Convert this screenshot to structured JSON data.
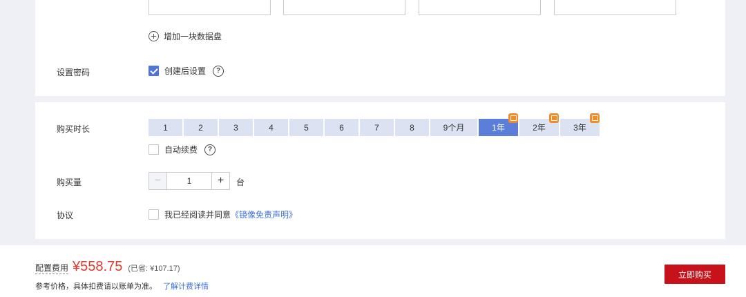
{
  "disk_section": {
    "add_disk_label": "增加一块数据盘"
  },
  "password": {
    "label": "设置密码",
    "option_label": "创建后设置",
    "checked": true
  },
  "duration": {
    "label": "购买时长",
    "options": [
      "1",
      "2",
      "3",
      "4",
      "5",
      "6",
      "7",
      "8",
      "9个月",
      "1年",
      "2年",
      "3年"
    ],
    "selected": "1年",
    "auto_renew_label": "自动续费",
    "auto_renew_checked": false
  },
  "quantity": {
    "label": "购买量",
    "value": "1",
    "minus": "−",
    "plus": "+",
    "unit": "台"
  },
  "agreement": {
    "label": "协议",
    "text": "我已经阅读并同意",
    "link_text": "《镜像免责声明》",
    "checked": false
  },
  "footer": {
    "price_label": "配置费用",
    "price": "¥558.75",
    "saved": "(已省: ¥107.17)",
    "note": "参考价格，具体扣费请以账单为准。",
    "note_link": "了解计费详情",
    "buy_button": "立即购买"
  },
  "colors": {
    "accent": "#5b7fd8",
    "price": "#e0392b",
    "buy_button": "#c8121b",
    "badge": "#f28c28"
  }
}
